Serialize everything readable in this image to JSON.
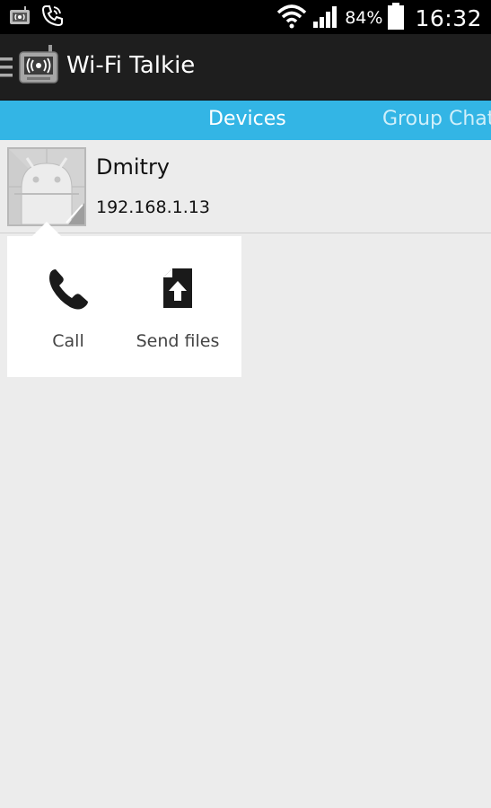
{
  "status_bar": {
    "battery_percent": "84%",
    "time": "16:32",
    "icons": [
      "wifi-talkie-notification-icon",
      "phone-call-icon",
      "wifi-signal-icon",
      "cell-signal-icon",
      "battery-icon"
    ]
  },
  "action_bar": {
    "title": "Wi-Fi Talkie",
    "icons": [
      "menu-icon",
      "app-logo-icon"
    ]
  },
  "tabs": [
    {
      "label": "Devices",
      "selected": true
    },
    {
      "label": "Group Chat",
      "selected": false
    }
  ],
  "devices": [
    {
      "name": "Dmitry",
      "ip": "192.168.1.13"
    }
  ],
  "popup": {
    "actions": [
      {
        "label": "Call",
        "icon": "phone-icon"
      },
      {
        "label": "Send files",
        "icon": "upload-file-icon"
      }
    ]
  },
  "colors": {
    "tab_bar": "#33b5e5",
    "action_bar": "#1e1e1e",
    "background": "#ececec",
    "status_bar": "#000000"
  }
}
